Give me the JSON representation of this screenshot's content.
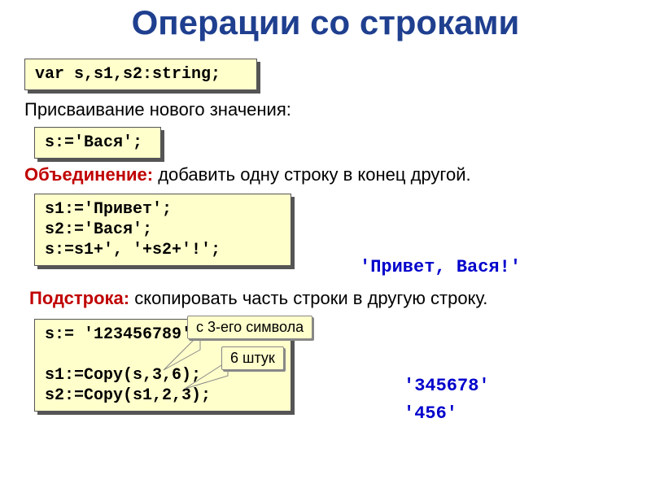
{
  "title": "Операции со строками",
  "code_var": "var s,s1,s2:string;",
  "label_assign": "Присваивание нового значения:",
  "code_assign": "s:='Вася';",
  "label_concat_bold": "Объединение:",
  "label_concat_rest": " добавить одну строку в конец другой.",
  "code_concat": "s1:='Привет';\ns2:='Вася';\ns:=s1+', '+s2+'!';",
  "out_concat": "'Привет, Вася!'",
  "label_substr_bold": "Подстрока:",
  "label_substr_rest": " скопировать часть строки в другую строку.",
  "code_copy": "s:= '123456789';\n\ns1:=Copy(s,3,6);\ns2:=Copy(s1,2,3);",
  "callout_from": "с 3-его символа",
  "callout_count": "6 штук",
  "out_copy1": "'345678'",
  "out_copy2": "'456'"
}
